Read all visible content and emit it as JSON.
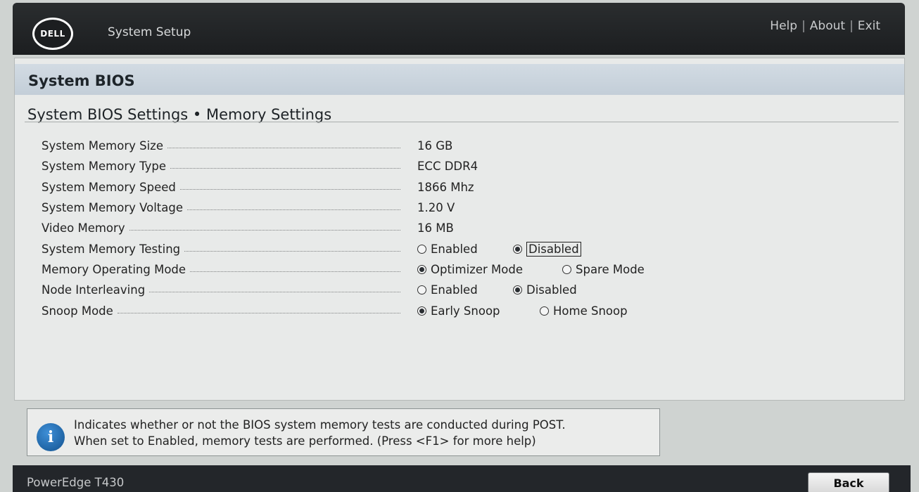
{
  "header": {
    "logo": "DELL",
    "title": "System Setup",
    "links": [
      "Help",
      "About",
      "Exit"
    ]
  },
  "section": {
    "title": "System BIOS"
  },
  "page": {
    "title": "System BIOS Settings • Memory Settings"
  },
  "settings": [
    {
      "label": "System Memory Size",
      "value": "16 GB"
    },
    {
      "label": "System Memory Type",
      "value": "ECC DDR4"
    },
    {
      "label": "System Memory Speed",
      "value": "1866 Mhz"
    },
    {
      "label": "System Memory Voltage",
      "value": "1.20 V"
    },
    {
      "label": "Video Memory",
      "value": "16 MB"
    },
    {
      "label": "System Memory Testing",
      "options": [
        "Enabled",
        "Disabled"
      ],
      "selected": "Disabled",
      "focused": "Disabled"
    },
    {
      "label": "Memory Operating Mode",
      "options": [
        "Optimizer Mode",
        "Spare Mode"
      ],
      "selected": "Optimizer Mode"
    },
    {
      "label": "Node Interleaving",
      "options": [
        "Enabled",
        "Disabled"
      ],
      "selected": "Disabled"
    },
    {
      "label": "Snoop Mode",
      "options": [
        "Early Snoop",
        "Home Snoop"
      ],
      "selected": "Early Snoop"
    }
  ],
  "help": {
    "icon": "info-icon",
    "line1": "Indicates whether or not the BIOS system memory tests are conducted during POST.",
    "line2": "When set to Enabled, memory tests are performed. (Press <F1> for more help)"
  },
  "footer": {
    "model": "PowerEdge T430",
    "back_label": "Back"
  }
}
